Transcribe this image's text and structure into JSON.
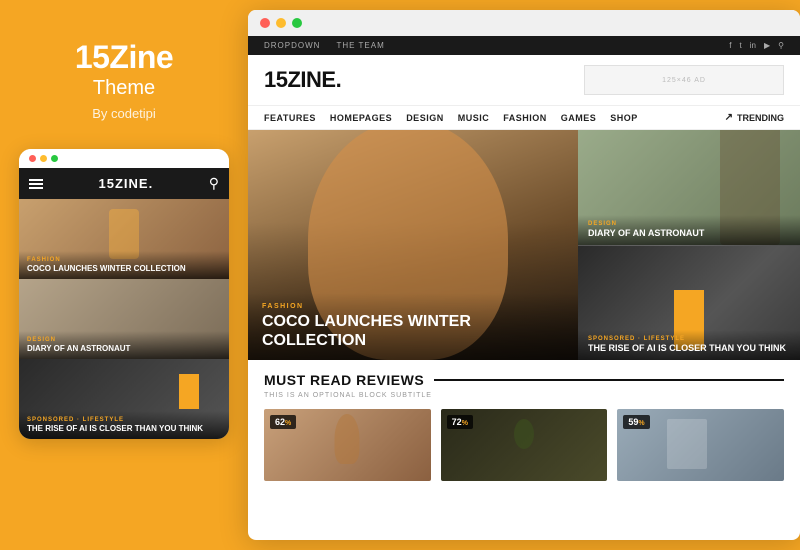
{
  "left": {
    "title": "15Zine",
    "subtitle": "Theme",
    "byline": "By codetipi",
    "mobile_dots": [
      {
        "color": "#ff5f57"
      },
      {
        "color": "#febc2e"
      },
      {
        "color": "#28c840"
      }
    ],
    "mobile_logo": "15ZINE.",
    "mobile_articles": [
      {
        "category": "FASHION",
        "title": "COCO LAUNCHES WINTER COLLECTION",
        "type": "fashion"
      },
      {
        "category": "DESIGN",
        "title": "DIARY OF AN ASTRONAUT",
        "type": "design"
      },
      {
        "category": "SPONSORED · LIFESTYLE",
        "title": "THE RISE OF AI IS CLOSER THAN YOU THINK",
        "type": "lifestyle"
      }
    ]
  },
  "browser": {
    "dots": [
      {
        "color": "#ff5f57"
      },
      {
        "color": "#febc2e"
      },
      {
        "color": "#28c840"
      }
    ],
    "nav_items": [
      "DROPDOWN",
      "THE TEAM"
    ],
    "social_icons": [
      "f",
      "t",
      "in",
      "▶",
      "♪"
    ],
    "site_logo": "15ZINE.",
    "ad_text": "125×46 AD",
    "menu_items": [
      "FEATURES",
      "HOMEPAGES",
      "DESIGN",
      "MUSIC",
      "FASHION",
      "GAMES",
      "SHOP"
    ],
    "trending_label": "TRENDING",
    "hero": {
      "category": "FASHION",
      "title": "COCO LAUNCHES WINTER COLLECTION"
    },
    "card_top": {
      "category": "DESIGN",
      "title": "DIARY OF AN ASTRONAUT"
    },
    "card_bottom": {
      "category": "SPONSORED · LIFESTYLE",
      "title": "THE RISE OF AI IS CLOSER THAN YOU THINK"
    },
    "must_read": {
      "title": "MUST READ REVIEWS",
      "subtitle": "THIS IS AN OPTIONAL BLOCK SUBTITLE",
      "reviews": [
        {
          "score": "62",
          "pct": "%"
        },
        {
          "score": "72",
          "pct": "%"
        },
        {
          "score": "59",
          "pct": "%"
        }
      ]
    }
  }
}
